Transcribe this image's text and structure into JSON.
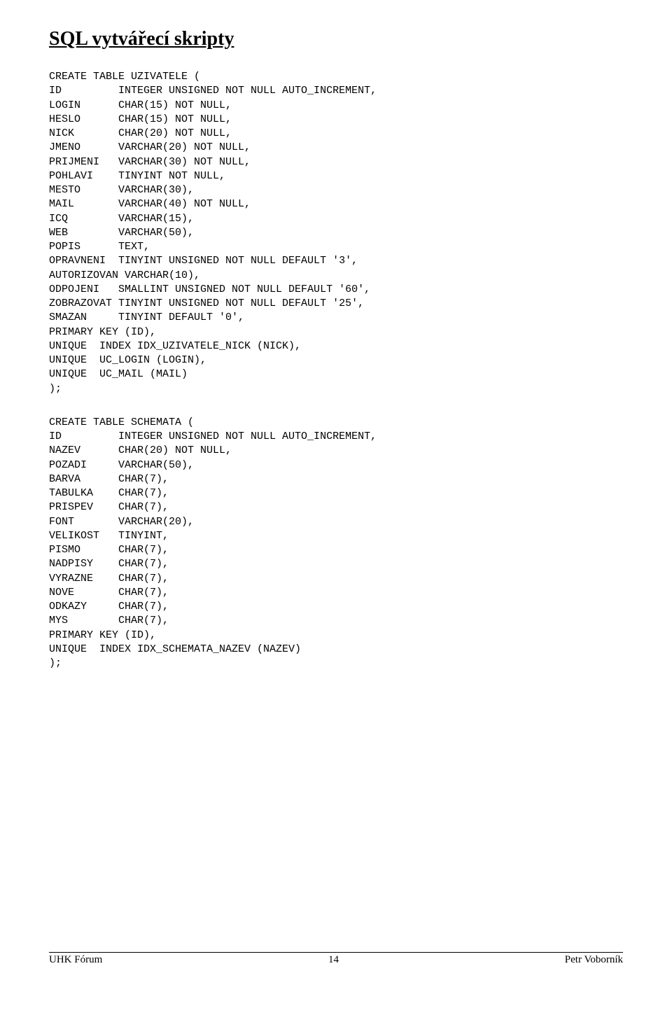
{
  "title": "SQL vytvářecí skripty",
  "code_block_1": "CREATE TABLE UZIVATELE (\nID         INTEGER UNSIGNED NOT NULL AUTO_INCREMENT,\nLOGIN      CHAR(15) NOT NULL,\nHESLO      CHAR(15) NOT NULL,\nNICK       CHAR(20) NOT NULL,\nJMENO      VARCHAR(20) NOT NULL,\nPRIJMENI   VARCHAR(30) NOT NULL,\nPOHLAVI    TINYINT NOT NULL,\nMESTO      VARCHAR(30),\nMAIL       VARCHAR(40) NOT NULL,\nICQ        VARCHAR(15),\nWEB        VARCHAR(50),\nPOPIS      TEXT,\nOPRAVNENI  TINYINT UNSIGNED NOT NULL DEFAULT '3',\nAUTORIZOVAN VARCHAR(10),\nODPOJENI   SMALLINT UNSIGNED NOT NULL DEFAULT '60',\nZOBRAZOVAT TINYINT UNSIGNED NOT NULL DEFAULT '25',\nSMAZAN     TINYINT DEFAULT '0',\nPRIMARY KEY (ID),\nUNIQUE  INDEX IDX_UZIVATELE_NICK (NICK),\nUNIQUE  UC_LOGIN (LOGIN),\nUNIQUE  UC_MAIL (MAIL)\n);",
  "code_block_2": "CREATE TABLE SCHEMATA (\nID         INTEGER UNSIGNED NOT NULL AUTO_INCREMENT,\nNAZEV      CHAR(20) NOT NULL,\nPOZADI     VARCHAR(50),\nBARVA      CHAR(7),\nTABULKA    CHAR(7),\nPRISPEV    CHAR(7),\nFONT       VARCHAR(20),\nVELIKOST   TINYINT,\nPISMO      CHAR(7),\nNADPISY    CHAR(7),\nVYRAZNE    CHAR(7),\nNOVE       CHAR(7),\nODKAZY     CHAR(7),\nMYS        CHAR(7),\nPRIMARY KEY (ID),\nUNIQUE  INDEX IDX_SCHEMATA_NAZEV (NAZEV)\n);",
  "footer": {
    "left": "UHK Fórum",
    "center": "14",
    "right": "Petr Voborník"
  }
}
